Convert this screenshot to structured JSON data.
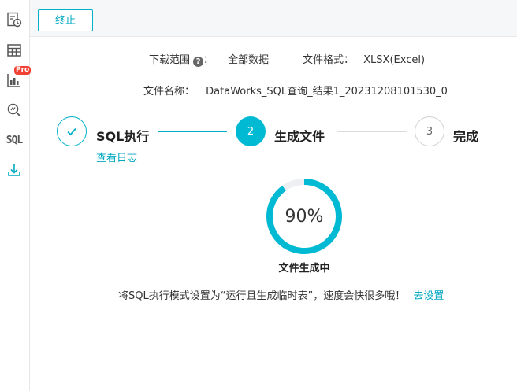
{
  "sidebar": {
    "items": [
      {
        "icon": "report-history-icon"
      },
      {
        "icon": "table-grid-icon"
      },
      {
        "icon": "bar-chart-pro-icon",
        "badge": "Pro"
      },
      {
        "icon": "search-analysis-icon"
      },
      {
        "icon": "sql-icon",
        "label": "SQL"
      },
      {
        "icon": "download-icon"
      }
    ]
  },
  "toolbar": {
    "stop_label": "终止"
  },
  "download_info": {
    "range_label": "下载范围",
    "range_value": "全部数据",
    "format_label": "文件格式：",
    "format_value": "XLSX(Excel)",
    "filename_label": "文件名称：",
    "filename_value": "DataWorks_SQL查询_结果1_20231208101530_0"
  },
  "steps": [
    {
      "label": "SQL执行",
      "status": "done",
      "link": "查看日志"
    },
    {
      "label": "生成文件",
      "status": "active",
      "number": "2"
    },
    {
      "label": "完成",
      "status": "wait",
      "number": "3"
    }
  ],
  "progress": {
    "percent": 90,
    "percent_text": "90%",
    "status_text": "文件生成中",
    "ring_color": "#00b9d3",
    "track_color": "#eeeff3"
  },
  "tip": {
    "text": "将SQL执行模式设置为“运行且生成临时表”，速度会快很多哦！",
    "link": "去设置"
  },
  "colors": {
    "accent": "#00b2c9"
  }
}
